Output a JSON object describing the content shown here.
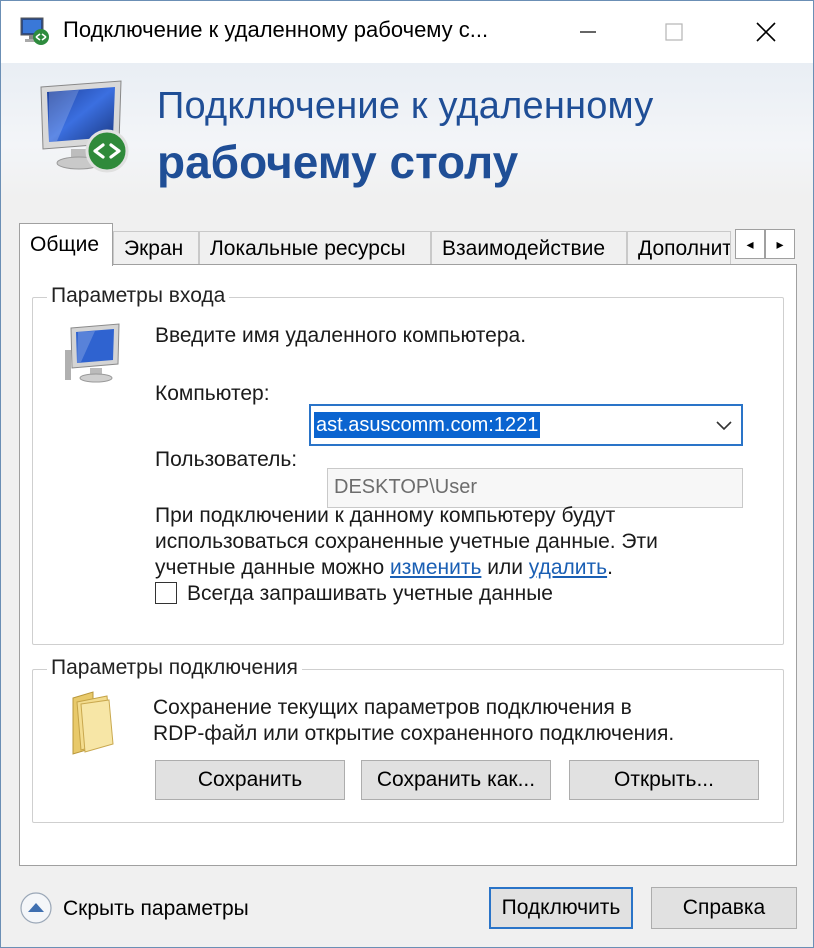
{
  "window": {
    "title": "Подключение к удаленному рабочему с...",
    "controls": {
      "minimize": "minimize-icon",
      "maximize": "maximize-icon",
      "close": "close-icon"
    }
  },
  "banner": {
    "line1": "Подключение к удаленному",
    "line2": "рабочему столу"
  },
  "tabs": [
    {
      "label": "Общие"
    },
    {
      "label": "Экран"
    },
    {
      "label": "Локальные ресурсы"
    },
    {
      "label": "Взаимодействие"
    },
    {
      "label": "Дополнит"
    }
  ],
  "tab_scroll": {
    "left": "◂",
    "right": "▸"
  },
  "login": {
    "group_title": "Параметры входа",
    "prompt": "Введите имя удаленного компьютера.",
    "computer_label": "Компьютер:",
    "computer_value": "ast.asuscomm.com:1221",
    "user_label": "Пользователь:",
    "user_value": "DESKTOP\\User",
    "info_line1": "При подключении к данному компьютеру будут",
    "info_line2": "использоваться сохраненные учетные данные. Эти",
    "info_line3_pre": "учетные данные можно ",
    "info_link_change": "изменить",
    "info_line3_mid": " или ",
    "info_link_delete": "удалить",
    "info_line3_post": ".",
    "always_ask_label": "Всегда запрашивать учетные данные",
    "always_ask_checked": false
  },
  "connection": {
    "group_title": "Параметры подключения",
    "desc_line1": "Сохранение текущих параметров подключения в",
    "desc_line2": "RDP-файл или открытие сохраненного подключения.",
    "save_label": "Сохранить",
    "save_as_label": "Сохранить как...",
    "open_label": "Открыть..."
  },
  "footer": {
    "toggle_label": "Скрыть параметры",
    "connect_label": "Подключить",
    "help_label": "Справка"
  },
  "colors": {
    "accent": "#2a74c8",
    "banner_text": "#1f4e96",
    "selection": "#0a64d0",
    "link": "#1a5fb4"
  }
}
